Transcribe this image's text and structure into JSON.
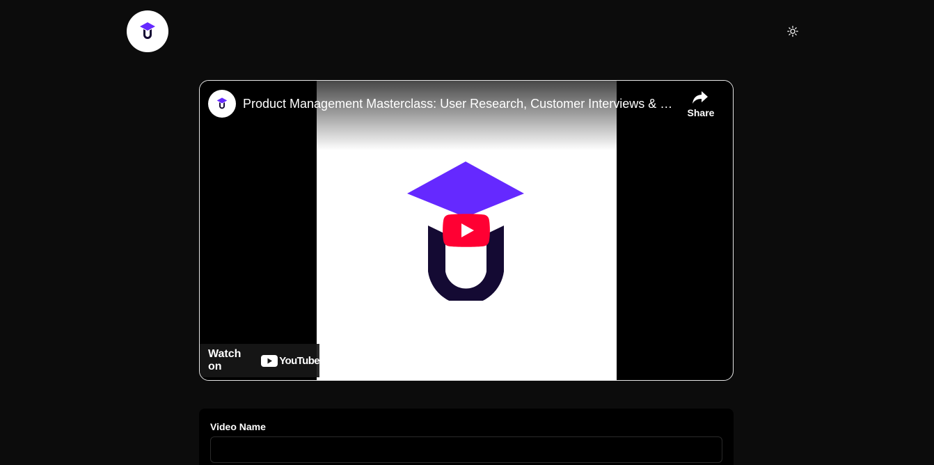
{
  "header": {
    "logo_icon": "graduation-cap-u-logo",
    "theme_toggle_icon": "sun-icon"
  },
  "video": {
    "title": "Product Management Masterclass: User Research, Customer Interviews & D...",
    "share_label": "Share",
    "watch_on_label": "Watch on",
    "youtube_wordmark": "YouTube",
    "play_icon": "youtube-play-icon",
    "thumbnail_icon": "graduation-cap-u-logo"
  },
  "form": {
    "video_name_label": "Video Name",
    "video_name_value": "",
    "video_name_placeholder": ""
  },
  "colors": {
    "background": "#0c0c0c",
    "brand_purple": "#6529ff",
    "brand_navy": "#140a33",
    "youtube_red": "#ff0033"
  }
}
